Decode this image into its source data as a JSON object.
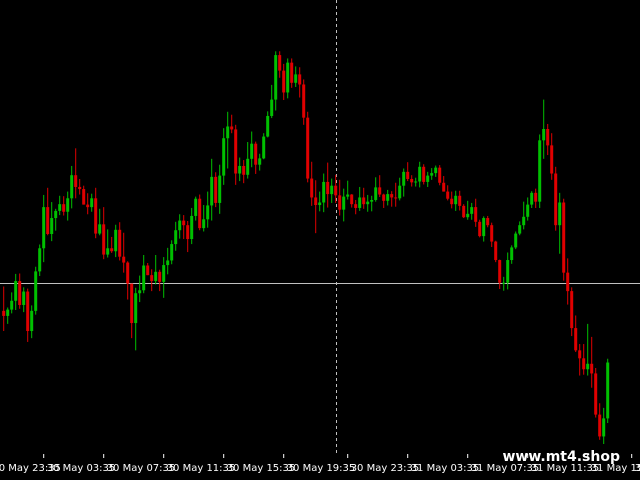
{
  "watermark": "www.mt4.shop",
  "colors": {
    "background": "#000000",
    "bull": "#00c000",
    "bear": "#e00000",
    "crosshair": "#c0c0c0",
    "text": "#ffffff"
  },
  "chart_data": {
    "type": "candlestick",
    "grid": false,
    "ylim": [
      0,
      100
    ],
    "x_ticks": [
      {
        "index": -2,
        "label": "0 May 23:35"
      },
      {
        "index": 10,
        "label": "30 May 03:35"
      },
      {
        "index": 25,
        "label": "30 May 07:35"
      },
      {
        "index": 40,
        "label": "30 May 11:35"
      },
      {
        "index": 55,
        "label": "30 May 15:35"
      },
      {
        "index": 70,
        "label": "30 May 19:35"
      },
      {
        "index": 86,
        "label": "30 May 23:35"
      },
      {
        "index": 101,
        "label": "31 May 03:35"
      },
      {
        "index": 116,
        "label": "31 May 07:35"
      },
      {
        "index": 131,
        "label": "31 May 11:35"
      },
      {
        "index": 146,
        "label": "31 May 15:35"
      },
      {
        "index": 157,
        "label": "3"
      }
    ],
    "crosshair": {
      "index": 83,
      "value": 38.3
    },
    "candles": [
      [
        31.7,
        37.5,
        26.9,
        30.5
      ],
      [
        30.5,
        32.5,
        28.6,
        32.0
      ],
      [
        32.0,
        36.1,
        31.1,
        34.1
      ],
      [
        34.1,
        40.5,
        31.9,
        38.8
      ],
      [
        38.8,
        40.6,
        32.2,
        33.1
      ],
      [
        33.1,
        37.3,
        31.4,
        36.3
      ],
      [
        36.3,
        37.0,
        24.3,
        26.9
      ],
      [
        26.9,
        33.0,
        25.2,
        31.7
      ],
      [
        31.7,
        42.2,
        30.8,
        41.1
      ],
      [
        41.1,
        47.5,
        40.0,
        46.6
      ],
      [
        46.6,
        59.3,
        43.3,
        56.4
      ],
      [
        56.4,
        61.0,
        49.7,
        50.0
      ],
      [
        50.0,
        57.6,
        48.3,
        53.8
      ],
      [
        53.8,
        56.0,
        50.8,
        55.5
      ],
      [
        55.5,
        59.1,
        54.5,
        57.1
      ],
      [
        57.1,
        59.0,
        54.4,
        55.3
      ],
      [
        55.3,
        60.1,
        53.2,
        58.5
      ],
      [
        58.5,
        66.2,
        56.1,
        64.0
      ],
      [
        64.0,
        70.4,
        58.5,
        61.2
      ],
      [
        61.2,
        63.1,
        59.4,
        60.7
      ],
      [
        60.7,
        61.5,
        57.0,
        57.0
      ],
      [
        57.0,
        59.7,
        54.7,
        56.4
      ],
      [
        56.4,
        59.6,
        55.3,
        58.5
      ],
      [
        58.5,
        61.0,
        49.0,
        50.1
      ],
      [
        50.1,
        56.0,
        49.7,
        52.3
      ],
      [
        52.3,
        56.4,
        44.0,
        45.1
      ],
      [
        45.1,
        51.1,
        44.4,
        46.6
      ],
      [
        46.6,
        49.3,
        45.5,
        45.9
      ],
      [
        45.9,
        52.2,
        44.5,
        51.0
      ],
      [
        51.0,
        52.8,
        43.7,
        44.6
      ],
      [
        44.6,
        50.3,
        40.8,
        43.2
      ],
      [
        43.2,
        43.5,
        34.4,
        38.2
      ],
      [
        38.2,
        38.2,
        25.2,
        28.8
      ],
      [
        28.8,
        37.2,
        22.3,
        35.9
      ],
      [
        35.9,
        40.1,
        33.8,
        36.6
      ],
      [
        36.6,
        45.0,
        35.9,
        42.5
      ],
      [
        42.5,
        43.1,
        40.2,
        40.2
      ],
      [
        40.2,
        41.6,
        36.4,
        38.8
      ],
      [
        38.8,
        45.0,
        38.0,
        41.0
      ],
      [
        41.0,
        41.5,
        36.4,
        38.6
      ],
      [
        38.6,
        44.5,
        34.8,
        42.6
      ],
      [
        42.6,
        46.7,
        40.4,
        43.7
      ],
      [
        43.7,
        48.5,
        42.8,
        47.6
      ],
      [
        47.6,
        52.9,
        46.0,
        50.9
      ],
      [
        50.9,
        54.7,
        48.9,
        53.2
      ],
      [
        53.2,
        54.5,
        48.8,
        52.1
      ],
      [
        52.1,
        53.1,
        45.7,
        48.8
      ],
      [
        48.8,
        56.2,
        47.6,
        54.3
      ],
      [
        54.3,
        58.9,
        53.2,
        58.4
      ],
      [
        58.4,
        59.4,
        50.9,
        51.4
      ],
      [
        51.4,
        56.9,
        50.6,
        53.5
      ],
      [
        53.5,
        60.1,
        51.5,
        56.8
      ],
      [
        56.8,
        67.9,
        53.2,
        63.6
      ],
      [
        63.6,
        64.7,
        56.4,
        57.4
      ],
      [
        57.4,
        66.5,
        54.8,
        63.9
      ],
      [
        63.9,
        75.2,
        61.7,
        72.8
      ],
      [
        72.8,
        79.1,
        65.6,
        75.6
      ],
      [
        75.6,
        78.4,
        74.0,
        74.9
      ],
      [
        74.9,
        76.0,
        61.7,
        64.4
      ],
      [
        64.4,
        68.2,
        62.6,
        66.2
      ],
      [
        66.2,
        67.6,
        62.1,
        64.1
      ],
      [
        64.1,
        71.9,
        63.2,
        67.9
      ],
      [
        67.9,
        74.4,
        65.9,
        71.5
      ],
      [
        71.5,
        72.0,
        64.3,
        66.5
      ],
      [
        66.5,
        69.1,
        65.1,
        68.0
      ],
      [
        68.0,
        74.0,
        67.8,
        73.2
      ],
      [
        73.2,
        79.2,
        73.0,
        78.1
      ],
      [
        78.1,
        85.5,
        77.6,
        82.0
      ],
      [
        82.0,
        93.5,
        79.4,
        92.6
      ],
      [
        92.6,
        93.5,
        87.2,
        88.9
      ],
      [
        88.9,
        90.5,
        81.9,
        83.7
      ],
      [
        83.7,
        91.8,
        82.3,
        90.8
      ],
      [
        90.8,
        91.8,
        84.8,
        86.0
      ],
      [
        86.0,
        89.9,
        85.0,
        88.0
      ],
      [
        88.0,
        89.7,
        82.5,
        85.6
      ],
      [
        85.6,
        86.8,
        76.0,
        77.7
      ],
      [
        77.7,
        79.1,
        62.3,
        63.2
      ],
      [
        63.2,
        67.2,
        56.7,
        58.7
      ],
      [
        58.7,
        62.8,
        50.2,
        56.9
      ],
      [
        56.9,
        60.1,
        55.4,
        57.5
      ],
      [
        57.5,
        64.4,
        55.2,
        62.4
      ],
      [
        62.4,
        67.0,
        56.3,
        59.5
      ],
      [
        59.5,
        63.2,
        57.4,
        61.5
      ],
      [
        61.5,
        64.1,
        57.4,
        59.2
      ],
      [
        59.2,
        62.9,
        54.4,
        55.8
      ],
      [
        55.8,
        60.8,
        53.0,
        58.9
      ],
      [
        58.9,
        62.7,
        58.2,
        59.4
      ],
      [
        59.4,
        59.5,
        56.3,
        57.1
      ],
      [
        57.1,
        58.1,
        54.7,
        56.2
      ],
      [
        56.2,
        61.2,
        55.5,
        58.7
      ],
      [
        58.7,
        61.0,
        56.0,
        57.1
      ],
      [
        57.1,
        59.3,
        55.3,
        57.7
      ],
      [
        57.7,
        59.1,
        55.4,
        58.1
      ],
      [
        58.1,
        63.5,
        57.7,
        61.1
      ],
      [
        61.1,
        64.0,
        58.8,
        59.4
      ],
      [
        59.4,
        59.6,
        56.2,
        57.9
      ],
      [
        57.9,
        60.5,
        56.8,
        59.5
      ],
      [
        59.5,
        60.2,
        56.5,
        58.7
      ],
      [
        58.7,
        62.2,
        56.5,
        58.5
      ],
      [
        58.5,
        63.4,
        58.0,
        61.5
      ],
      [
        61.5,
        65.6,
        58.9,
        64.8
      ],
      [
        64.8,
        67.1,
        62.6,
        63.1
      ],
      [
        63.1,
        64.0,
        61.3,
        62.3
      ],
      [
        62.3,
        63.4,
        61.3,
        62.5
      ],
      [
        62.5,
        67.2,
        61.1,
        66.0
      ],
      [
        66.0,
        66.6,
        61.8,
        62.4
      ],
      [
        62.4,
        64.8,
        61.2,
        63.9
      ],
      [
        63.9,
        65.7,
        62.9,
        64.5
      ],
      [
        64.5,
        66.3,
        63.6,
        65.8
      ],
      [
        65.8,
        66.4,
        61.6,
        62.2
      ],
      [
        62.2,
        63.8,
        60.1,
        60.1
      ],
      [
        60.1,
        61.6,
        58.0,
        58.4
      ],
      [
        58.4,
        60.1,
        56.1,
        57.1
      ],
      [
        57.1,
        60.3,
        55.5,
        59.1
      ],
      [
        59.1,
        60.3,
        55.6,
        56.7
      ],
      [
        56.7,
        57.1,
        53.8,
        54.0
      ],
      [
        54.0,
        57.9,
        53.4,
        54.8
      ],
      [
        54.8,
        57.4,
        53.4,
        56.4
      ],
      [
        56.4,
        58.4,
        51.7,
        52.9
      ],
      [
        52.9,
        53.4,
        49.2,
        49.5
      ],
      [
        49.5,
        54.2,
        48.2,
        53.8
      ],
      [
        53.8,
        54.3,
        51.6,
        52.1
      ],
      [
        52.1,
        52.7,
        46.9,
        48.2
      ],
      [
        48.2,
        48.4,
        43.3,
        43.8
      ],
      [
        43.8,
        43.9,
        36.9,
        38.4
      ],
      [
        38.4,
        39.8,
        36.5,
        38.4
      ],
      [
        38.4,
        45.6,
        36.8,
        43.8
      ],
      [
        43.8,
        47.3,
        42.9,
        46.8
      ],
      [
        46.8,
        50.6,
        46.4,
        50.1
      ],
      [
        50.1,
        53.0,
        49.7,
        52.1
      ],
      [
        52.1,
        57.7,
        51.1,
        54.1
      ],
      [
        54.1,
        58.7,
        53.2,
        57.0
      ],
      [
        57.0,
        60.2,
        56.2,
        59.8
      ],
      [
        59.8,
        60.8,
        56.2,
        57.7
      ],
      [
        57.7,
        73.7,
        56.2,
        72.3
      ],
      [
        72.3,
        82.0,
        67.9,
        75.0
      ],
      [
        75.0,
        76.2,
        68.8,
        71.1
      ],
      [
        71.1,
        74.0,
        62.9,
        64.4
      ],
      [
        64.4,
        66.0,
        50.8,
        52.1
      ],
      [
        52.1,
        59.8,
        45.3,
        57.5
      ],
      [
        57.5,
        58.4,
        38.9,
        40.8
      ],
      [
        40.8,
        44.2,
        33.2,
        36.4
      ],
      [
        36.4,
        37.3,
        25.7,
        27.6
      ],
      [
        27.6,
        30.6,
        21.9,
        22.3
      ],
      [
        22.3,
        23.8,
        16.3,
        20.4
      ],
      [
        20.4,
        23.8,
        16.5,
        17.8
      ],
      [
        17.8,
        28.6,
        16.3,
        19.1
      ],
      [
        19.1,
        25.5,
        13.4,
        16.8
      ],
      [
        16.8,
        18.1,
        6.3,
        7.0
      ],
      [
        7.0,
        9.7,
        1.0,
        1.8
      ],
      [
        1.8,
        8.6,
        0.0,
        6.1
      ],
      [
        6.1,
        20.3,
        5.0,
        19.4
      ]
    ]
  }
}
